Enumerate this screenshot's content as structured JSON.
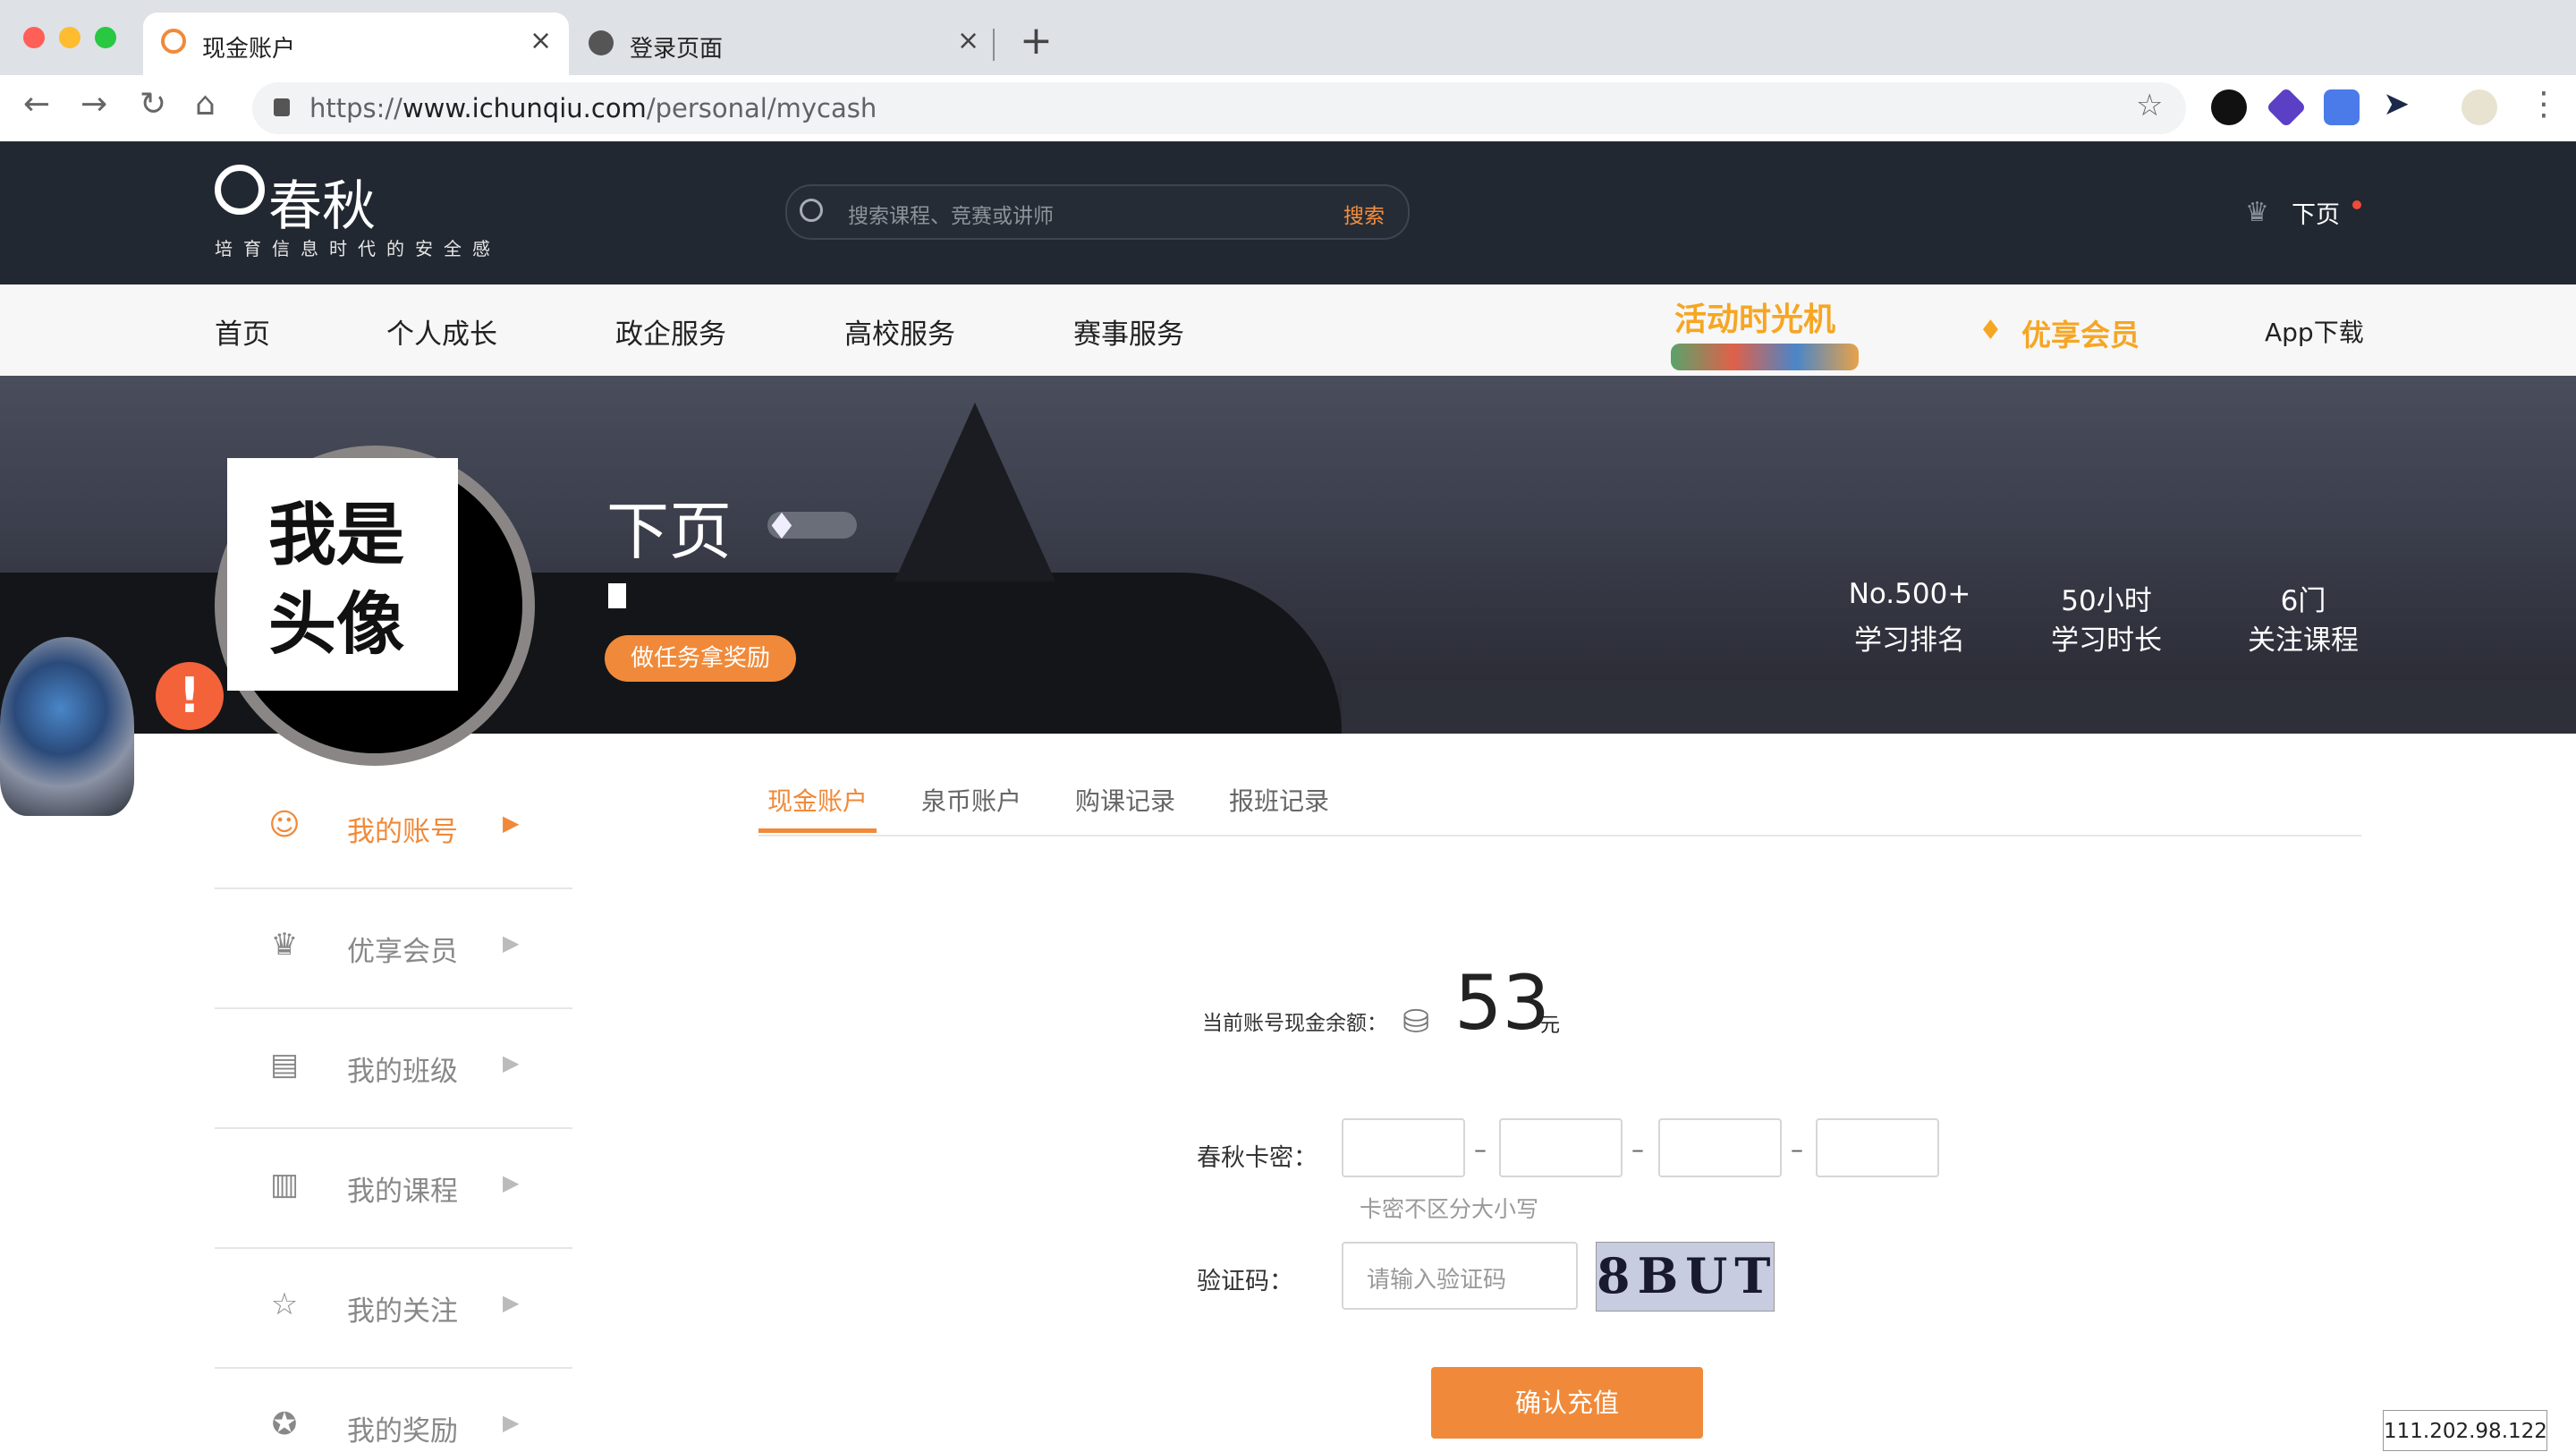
{
  "browser": {
    "tabs": [
      {
        "title": "现金账户",
        "active": true
      },
      {
        "title": "登录页面",
        "active": false
      }
    ],
    "url_scheme": "https://",
    "url_host": "www.ichunqiu.com",
    "url_path": "/personal/mycash",
    "extensions": [
      "qcode-ext-icon",
      "gem-ext-icon",
      "translate-ext-icon",
      "cursor-ext-icon",
      "profile-avatar"
    ]
  },
  "header": {
    "logo_text": "春秋",
    "logo_sub": "培育信息时代的安全感",
    "search_placeholder": "搜索课程、竞赛或讲师",
    "search_button": "搜索",
    "username": "下页"
  },
  "nav": {
    "items": [
      "首页",
      "个人成长",
      "政企服务",
      "高校服务",
      "赛事服务"
    ],
    "activity": "活动时光机",
    "vip": "优享会员",
    "app": "App下载"
  },
  "profile": {
    "avatar_text": "我是头像",
    "name": "下页",
    "task_button": "做任务拿奖励",
    "stats": [
      {
        "value": "No.500+",
        "label": "学习排名"
      },
      {
        "value": "50小时",
        "label": "学习时长"
      },
      {
        "value": "6门",
        "label": "关注课程"
      }
    ]
  },
  "sidebar": {
    "items": [
      {
        "label": "我的账号",
        "icon": "user-icon",
        "active": true
      },
      {
        "label": "优享会员",
        "icon": "crown-icon",
        "active": false
      },
      {
        "label": "我的班级",
        "icon": "class-icon",
        "active": false
      },
      {
        "label": "我的课程",
        "icon": "book-icon",
        "active": false
      },
      {
        "label": "我的关注",
        "icon": "star-icon",
        "active": false
      },
      {
        "label": "我的奖励",
        "icon": "award-icon",
        "active": false
      }
    ]
  },
  "content": {
    "tabs": [
      "现金账户",
      "泉币账户",
      "购课记录",
      "报班记录"
    ],
    "balance_label": "当前账号现金余额：",
    "balance_value": "53",
    "balance_unit": "元",
    "card_label": "春秋卡密：",
    "card_hint": "卡密不区分大小写",
    "vcode_label": "验证码：",
    "vcode_placeholder": "请输入验证码",
    "captcha_text": "8BUT",
    "confirm_button": "确认充值"
  },
  "footer": {
    "ip": "111.202.98.122"
  },
  "colors": {
    "accent": "#f08a3a",
    "header_bg": "#222831",
    "vip_gold": "#f5a623"
  }
}
